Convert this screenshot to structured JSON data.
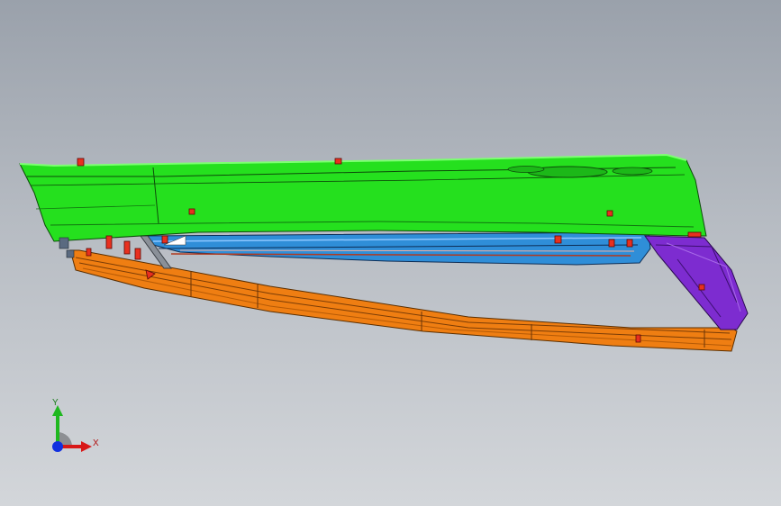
{
  "viewport": {
    "background_top": "#9aa1ab",
    "background_bottom": "#d3d6da"
  },
  "model": {
    "parts": [
      {
        "name": "green-side-sill-cover",
        "color": "#25e01e"
      },
      {
        "name": "blue-inner-reinforcement",
        "color": "#2f8ed8"
      },
      {
        "name": "orange-lower-rail",
        "color": "#ef7e12"
      },
      {
        "name": "purple-end-cap",
        "color": "#7d2cd0"
      },
      {
        "name": "red-clips",
        "color": "#e8301f"
      }
    ]
  },
  "triad": {
    "y_label": "Y",
    "x_label": "X",
    "y_color": "#1fb81f",
    "x_color": "#d81818",
    "z_color": "#1030e0"
  }
}
